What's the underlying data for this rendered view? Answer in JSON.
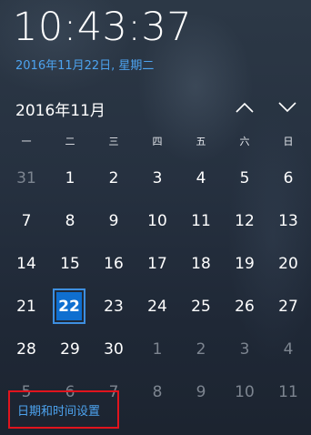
{
  "clock": {
    "time": "10:43:37",
    "date": "2016年11月22日, 星期二"
  },
  "calendar": {
    "month_label": "2016年11月",
    "nav": {
      "up_icon": "chevron-up-icon",
      "down_icon": "chevron-down-icon"
    },
    "weekdays": [
      "一",
      "二",
      "三",
      "四",
      "五",
      "六",
      "日"
    ],
    "weeks": [
      [
        {
          "d": "31",
          "other": true
        },
        {
          "d": "1"
        },
        {
          "d": "2"
        },
        {
          "d": "3"
        },
        {
          "d": "4"
        },
        {
          "d": "5"
        },
        {
          "d": "6"
        }
      ],
      [
        {
          "d": "7"
        },
        {
          "d": "8"
        },
        {
          "d": "9"
        },
        {
          "d": "10"
        },
        {
          "d": "11"
        },
        {
          "d": "12"
        },
        {
          "d": "13"
        }
      ],
      [
        {
          "d": "14"
        },
        {
          "d": "15"
        },
        {
          "d": "16"
        },
        {
          "d": "17"
        },
        {
          "d": "18"
        },
        {
          "d": "19"
        },
        {
          "d": "20"
        }
      ],
      [
        {
          "d": "21"
        },
        {
          "d": "22",
          "today": true
        },
        {
          "d": "23"
        },
        {
          "d": "24"
        },
        {
          "d": "25"
        },
        {
          "d": "26"
        },
        {
          "d": "27"
        }
      ],
      [
        {
          "d": "28"
        },
        {
          "d": "29"
        },
        {
          "d": "30"
        },
        {
          "d": "1",
          "other": true
        },
        {
          "d": "2",
          "other": true
        },
        {
          "d": "3",
          "other": true
        },
        {
          "d": "4",
          "other": true
        }
      ],
      [
        {
          "d": "5",
          "other": true
        },
        {
          "d": "6",
          "other": true
        },
        {
          "d": "7",
          "other": true
        },
        {
          "d": "8",
          "other": true
        },
        {
          "d": "9",
          "other": true
        },
        {
          "d": "10",
          "other": true
        },
        {
          "d": "11",
          "other": true
        }
      ]
    ]
  },
  "settings_link": {
    "label": "日期和时间设置"
  },
  "colors": {
    "accent": "#4da3ef",
    "today_fill": "#0f6fd0",
    "highlight_border": "#e0141d"
  }
}
